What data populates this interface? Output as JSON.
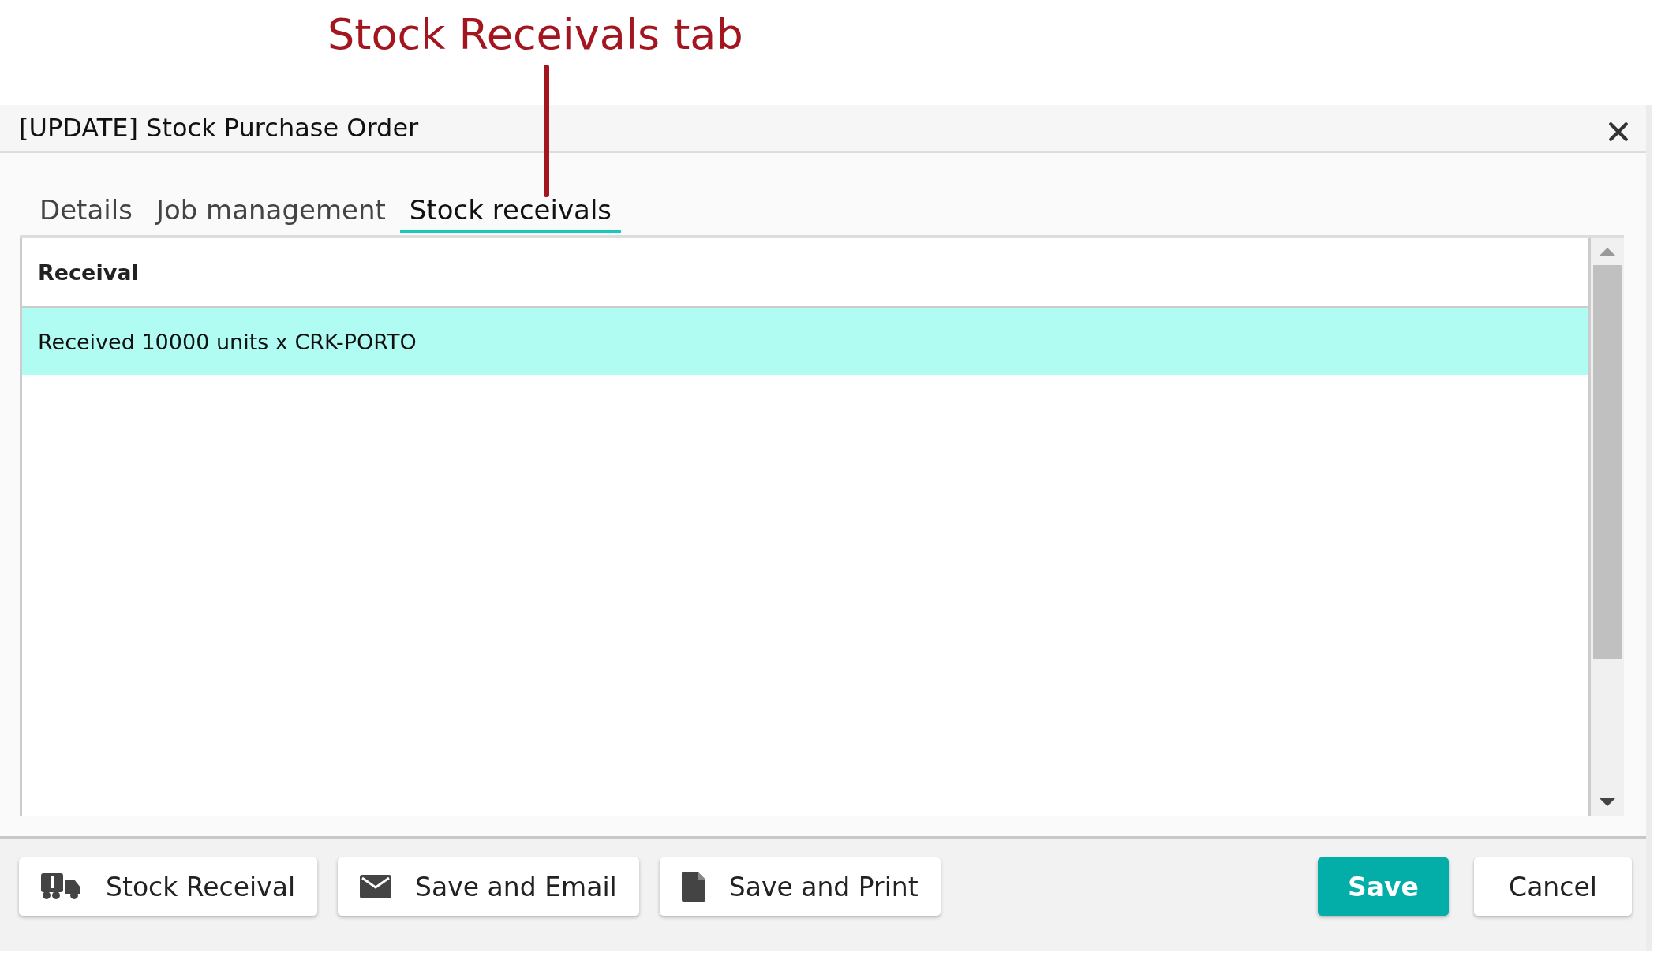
{
  "annotation": {
    "text": "Stock Receivals tab"
  },
  "window": {
    "title": "[UPDATE] Stock Purchase Order"
  },
  "tabs": [
    {
      "label": "Details",
      "selected": false
    },
    {
      "label": "Job management",
      "selected": false
    },
    {
      "label": "Stock receivals",
      "selected": true
    }
  ],
  "table": {
    "columns": [
      "Receival"
    ],
    "rows": [
      {
        "cells": [
          "Received 10000 units x CRK-PORTO"
        ],
        "selected": true
      }
    ]
  },
  "footer_buttons": [
    {
      "label": "Stock Receival",
      "kind": "truck"
    },
    {
      "label": "Save and Email",
      "kind": "mail"
    },
    {
      "label": "Save and Print",
      "kind": "pdf"
    }
  ],
  "actions": [
    {
      "label": "Save",
      "kind": "primary"
    },
    {
      "label": "Cancel",
      "kind": "secondary"
    }
  ]
}
